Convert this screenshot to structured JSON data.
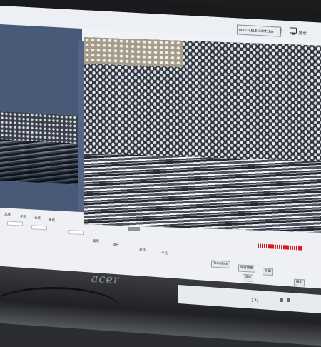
{
  "topbar": {
    "camera_select_value": "MR OSELE CAMERA",
    "display_label": "显示",
    "help_icon": "help-icon"
  },
  "toolbar": {
    "labels": [
      "宽度",
      "步距",
      "长度",
      "角度",
      "面积",
      "周长",
      "直径",
      "半径"
    ],
    "button_template": "Template",
    "button_save": "保存数据",
    "button_export": "导出",
    "button_ok": "确定",
    "button_add": "添加"
  },
  "taskbar": {
    "time": "17:"
  },
  "brand": "acer",
  "colors": {
    "slate": "#495a79",
    "viewer": "#536484",
    "annotation": "#e0191f"
  }
}
